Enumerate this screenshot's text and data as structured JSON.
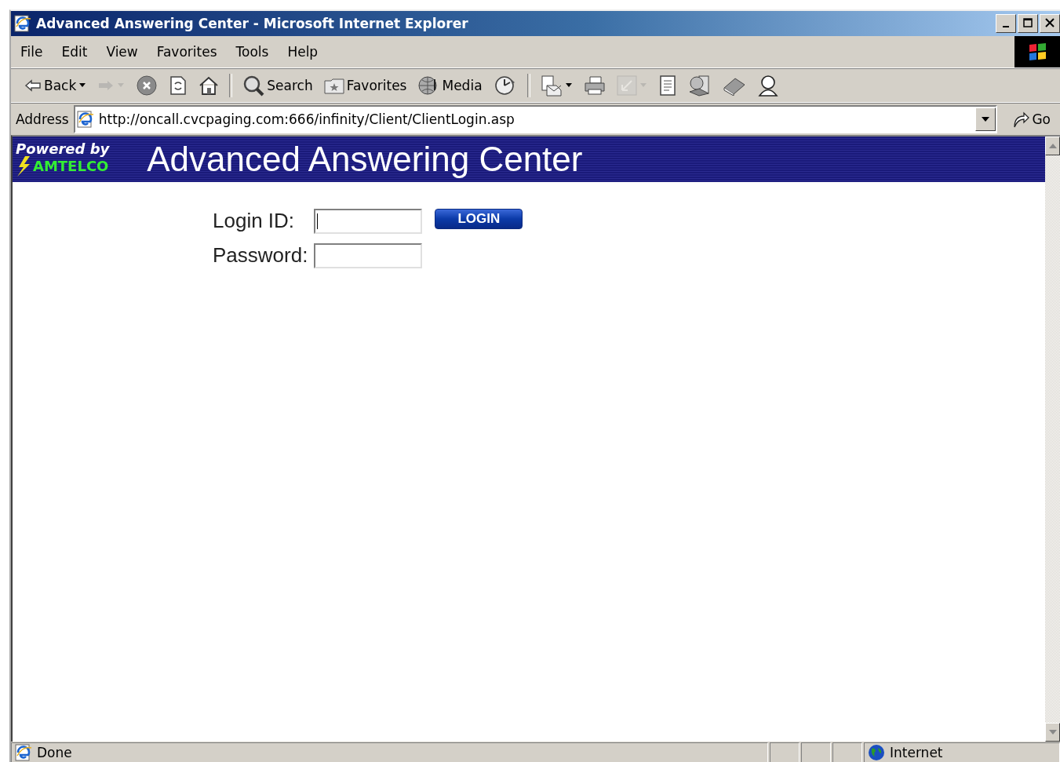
{
  "window": {
    "title": "Advanced Answering Center - Microsoft Internet Explorer"
  },
  "menu": [
    "File",
    "Edit",
    "View",
    "Favorites",
    "Tools",
    "Help"
  ],
  "toolbar": [
    {
      "kind": "back",
      "label": "Back",
      "dropdown": true,
      "disabled": false
    },
    {
      "kind": "forward",
      "dropdown": true,
      "disabled": true
    },
    {
      "kind": "stop",
      "dropdown": false,
      "disabled": false
    },
    {
      "kind": "refresh",
      "dropdown": false,
      "disabled": false
    },
    {
      "kind": "home",
      "dropdown": false,
      "disabled": false
    },
    {
      "kind": "separator"
    },
    {
      "kind": "search",
      "label": "Search",
      "dropdown": false,
      "disabled": false
    },
    {
      "kind": "favorites",
      "label": "Favorites",
      "dropdown": false,
      "disabled": false
    },
    {
      "kind": "media",
      "label": "Media",
      "dropdown": false,
      "disabled": false
    },
    {
      "kind": "history",
      "dropdown": false,
      "disabled": false
    },
    {
      "kind": "separator"
    },
    {
      "kind": "mail",
      "dropdown": true,
      "disabled": false
    },
    {
      "kind": "print",
      "dropdown": false,
      "disabled": false
    },
    {
      "kind": "edit",
      "dropdown": true,
      "disabled": true
    },
    {
      "kind": "page",
      "dropdown": false,
      "disabled": false
    },
    {
      "kind": "messenger",
      "dropdown": false,
      "disabled": false
    },
    {
      "kind": "book",
      "dropdown": false,
      "disabled": false
    },
    {
      "kind": "person",
      "dropdown": false,
      "disabled": false
    }
  ],
  "address": {
    "label": "Address",
    "url": "http://oncall.cvcpaging.com:666/infinity/Client/ClientLogin.asp",
    "go": "Go"
  },
  "header": {
    "powered_by": "Powered by",
    "brand": "AMTELCO",
    "title": "Advanced Answering Center"
  },
  "form": {
    "login_label": "Login ID:",
    "login_focused": true,
    "password_label": "Password:",
    "button": "LOGIN"
  },
  "status_bar": {
    "text": "Done",
    "zone": "Internet"
  }
}
